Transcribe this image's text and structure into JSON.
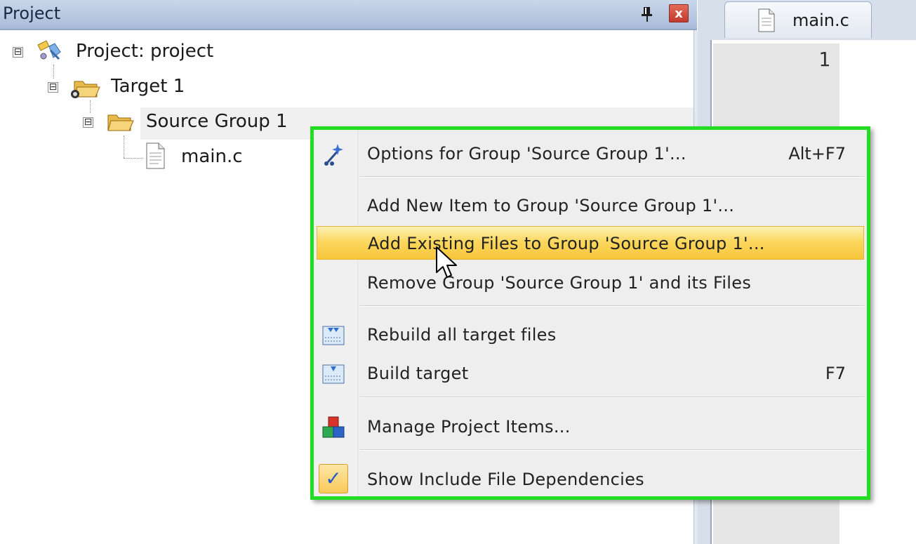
{
  "project_panel": {
    "title": "Project",
    "close_glyph": "x",
    "icons": {
      "pin": "pin-icon",
      "close": "close-icon"
    }
  },
  "tree": {
    "project": {
      "label": "Project: project",
      "icon": "project-icon",
      "expander": "⊟"
    },
    "target": {
      "label": "Target 1",
      "icon": "target-folder-icon",
      "expander": "⊟"
    },
    "group": {
      "label": "Source Group 1",
      "icon": "folder-icon",
      "expander": "⊟"
    },
    "file": {
      "label": "main.c",
      "icon": "file-icon"
    }
  },
  "editor": {
    "tab_label": "main.c",
    "line_number": "1"
  },
  "context_menu": {
    "items": [
      {
        "label": "Options for Group 'Source Group 1'...",
        "shortcut": "Alt+F7",
        "icon": "options-wand-icon"
      },
      {
        "label": "Add New  Item to Group 'Source Group 1'...",
        "shortcut": ""
      },
      {
        "label": "Add Existing Files to Group 'Source Group 1'...",
        "shortcut": "",
        "highlighted": true
      },
      {
        "label": "Remove Group 'Source Group 1' and its Files",
        "shortcut": ""
      },
      {
        "label": "Rebuild all target files",
        "shortcut": "",
        "icon": "rebuild-icon"
      },
      {
        "label": "Build target",
        "shortcut": "F7",
        "icon": "build-icon"
      },
      {
        "label": "Manage Project Items...",
        "shortcut": "",
        "icon": "manage-items-icon"
      },
      {
        "label": "Show Include File Dependencies",
        "shortcut": "",
        "checked": true,
        "check_glyph": "✓"
      }
    ]
  },
  "colors": {
    "menu_border": "#22dd22",
    "highlight": "#fbd85f",
    "header": "#b8c9e1"
  }
}
